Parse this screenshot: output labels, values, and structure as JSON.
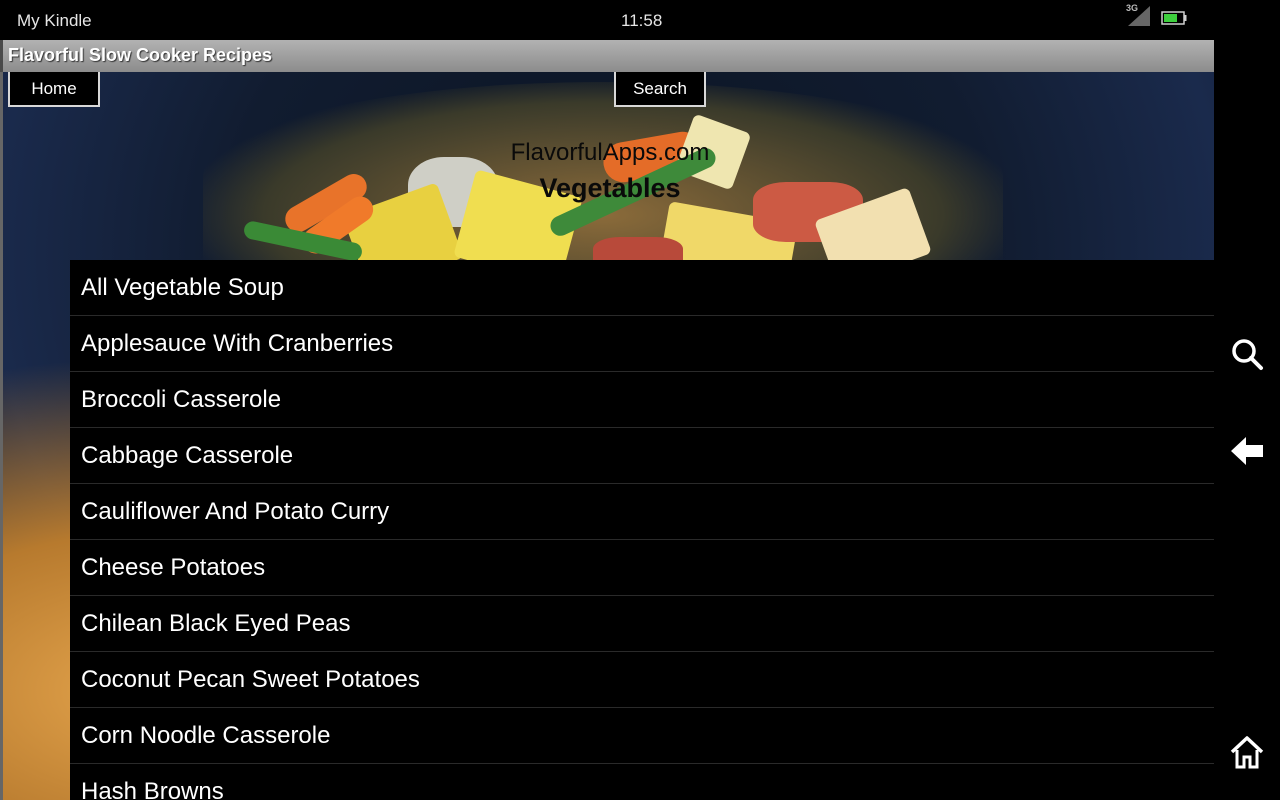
{
  "status_bar": {
    "device_name": "My Kindle",
    "time": "11:58",
    "signal_label": "3G",
    "signal_icon": "cellular-signal-icon",
    "battery_icon": "battery-icon",
    "battery_color": "#3ecf3e"
  },
  "title_bar": {
    "title": "Flavorful Slow Cooker Recipes"
  },
  "toolbar": {
    "home_label": "Home",
    "search_label": "Search"
  },
  "header": {
    "site": "FlavorfulApps.com",
    "category": "Vegetables"
  },
  "recipes": [
    "All Vegetable Soup",
    "Applesauce With Cranberries",
    "Broccoli Casserole",
    "Cabbage Casserole",
    "Cauliflower And Potato Curry",
    "Cheese Potatoes",
    "Chilean Black Eyed Peas",
    "Coconut Pecan Sweet Potatoes",
    "Corn Noodle Casserole",
    "Hash Browns"
  ],
  "nav": {
    "search_icon": "search-icon",
    "back_icon": "back-arrow-icon",
    "home_icon": "home-icon"
  }
}
